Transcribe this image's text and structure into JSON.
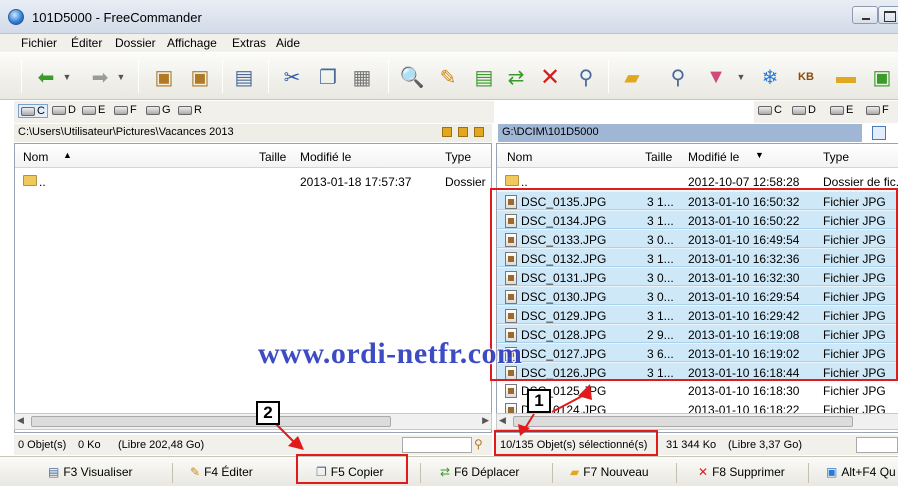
{
  "window": {
    "title": "101D5000 - FreeCommander"
  },
  "menu": [
    "Fichier",
    "Éditer",
    "Dossier",
    "Affichage",
    "Extras",
    "Aide"
  ],
  "left": {
    "drives": [
      "C",
      "D",
      "E",
      "F",
      "G",
      "R"
    ],
    "path": "C:\\Users\\Utilisateur\\Pictures\\Vacances 2013",
    "columns": {
      "name": "Nom",
      "size": "Taille",
      "modified": "Modifié le",
      "type": "Type"
    },
    "rows": [
      {
        "name": "..",
        "size": "",
        "modified": "2013-01-18 17:57:37",
        "type": "Dossier"
      }
    ],
    "status": {
      "objects": "0 Objet(s)",
      "size": "0 Ko",
      "free": "(Libre 202,48 Go)"
    }
  },
  "right": {
    "drives": [
      "C",
      "D",
      "E",
      "F"
    ],
    "path": "G:\\DCIM\\101D5000",
    "columns": {
      "name": "Nom",
      "size": "Taille",
      "modified": "Modifié le",
      "type": "Type"
    },
    "rows": [
      {
        "name": "..",
        "size": "",
        "modified": "2012-10-07 12:58:28",
        "type": "Dossier de fic."
      },
      {
        "name": "DSC_0135.JPG",
        "size": "3 1...",
        "modified": "2013-01-10 16:50:32",
        "type": "Fichier JPG"
      },
      {
        "name": "DSC_0134.JPG",
        "size": "3 1...",
        "modified": "2013-01-10 16:50:22",
        "type": "Fichier JPG"
      },
      {
        "name": "DSC_0133.JPG",
        "size": "3 0...",
        "modified": "2013-01-10 16:49:54",
        "type": "Fichier JPG"
      },
      {
        "name": "DSC_0132.JPG",
        "size": "3 1...",
        "modified": "2013-01-10 16:32:36",
        "type": "Fichier JPG"
      },
      {
        "name": "DSC_0131.JPG",
        "size": "3 0...",
        "modified": "2013-01-10 16:32:30",
        "type": "Fichier JPG"
      },
      {
        "name": "DSC_0130.JPG",
        "size": "3 0...",
        "modified": "2013-01-10 16:29:54",
        "type": "Fichier JPG"
      },
      {
        "name": "DSC_0129.JPG",
        "size": "3 1...",
        "modified": "2013-01-10 16:29:42",
        "type": "Fichier JPG"
      },
      {
        "name": "DSC_0128.JPG",
        "size": "2 9...",
        "modified": "2013-01-10 16:19:08",
        "type": "Fichier JPG"
      },
      {
        "name": "DSC_0127.JPG",
        "size": "3 6...",
        "modified": "2013-01-10 16:19:02",
        "type": "Fichier JPG"
      },
      {
        "name": "DSC_0126.JPG",
        "size": "3 1...",
        "modified": "2013-01-10 16:18:44",
        "type": "Fichier JPG"
      },
      {
        "name": "DSC_0125.JPG",
        "size": "",
        "modified": "2013-01-10 16:18:30",
        "type": "Fichier JPG"
      },
      {
        "name": "DSC_0124.JPG",
        "size": "",
        "modified": "2013-01-10 16:18:22",
        "type": "Fichier JPG"
      }
    ],
    "status": {
      "objects": "10/135 Objet(s) sélectionné(s)",
      "size": "31 344 Ko",
      "free": "(Libre 3,37 Go)"
    }
  },
  "fkeys": {
    "f3": "F3 Visualiser",
    "f4": "F4 Éditer",
    "f5": "F5 Copier",
    "f6": "F6 Déplacer",
    "f7": "F7 Nouveau",
    "f8": "F8 Supprimer",
    "quit": "Alt+F4 Qu"
  },
  "annotations": {
    "callout1": "1",
    "callout2": "2",
    "watermark": "www.ordi-netfr.com"
  },
  "colors": {
    "selection": "#cfe8f7",
    "highlight": "#e01b1b",
    "watermark": "#2e3dbf"
  }
}
